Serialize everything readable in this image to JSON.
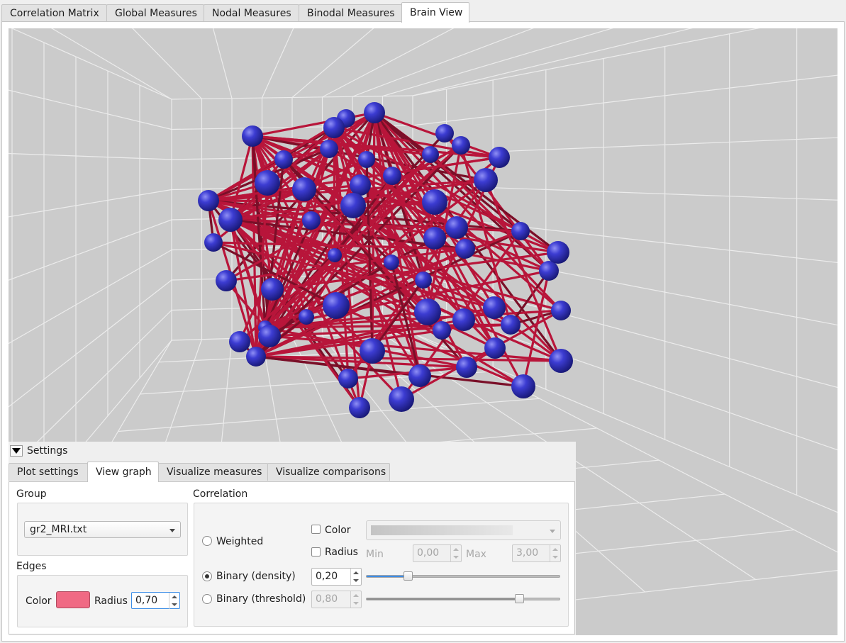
{
  "main_tabs": [
    {
      "label": "Correlation Matrix",
      "active": false
    },
    {
      "label": "Global Measures",
      "active": false
    },
    {
      "label": "Nodal Measures",
      "active": false
    },
    {
      "label": "Binodal Measures",
      "active": false
    },
    {
      "label": "Brain View",
      "active": true
    }
  ],
  "scene": {
    "background_color": "#cbcbcb",
    "grid_color": "#ececec",
    "node_color": "#2b2bb8",
    "edge_color": "#b8153a"
  },
  "settings": {
    "title": "Settings",
    "expanded": true,
    "tabs": [
      {
        "label": "Plot settings",
        "active": false
      },
      {
        "label": "View graph",
        "active": true
      },
      {
        "label": "Visualize measures",
        "active": false
      },
      {
        "label": "Visualize comparisons",
        "active": false
      }
    ],
    "group": {
      "label": "Group",
      "selected": "gr2_MRI.txt"
    },
    "edges": {
      "label": "Edges",
      "color_label": "Color",
      "color_value": "#f06a84",
      "radius_label": "Radius",
      "radius_value": "0,70"
    },
    "correlation": {
      "label": "Correlation",
      "weighted_label": "Weighted",
      "weighted_selected": false,
      "color_label": "Color",
      "color_checked": false,
      "radius_label": "Radius",
      "radius_checked": false,
      "min_label": "Min",
      "min_value": "0,00",
      "max_label": "Max",
      "max_value": "3,00",
      "binary_density_label": "Binary (density)",
      "binary_density_selected": true,
      "density_value": "0,20",
      "density_slider_fraction": 0.2,
      "binary_threshold_label": "Binary (threshold)",
      "binary_threshold_selected": false,
      "threshold_value": "0,80",
      "threshold_slider_fraction": 0.8
    }
  }
}
